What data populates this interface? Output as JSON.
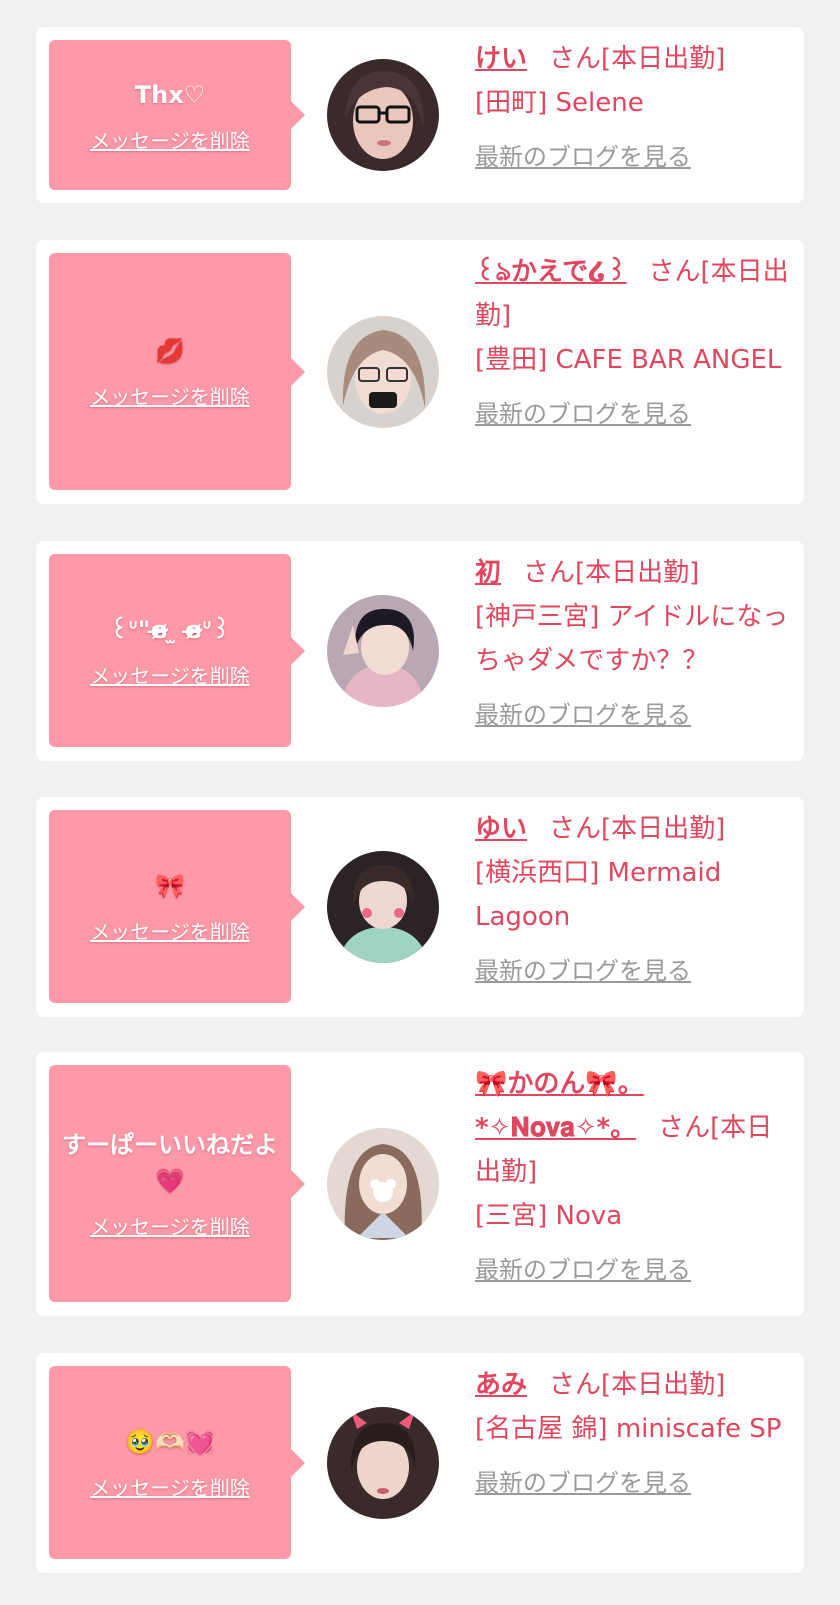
{
  "colors": {
    "accent": "#e0475f",
    "bubble": "#fd99a8",
    "background": "#f1f1f2"
  },
  "common": {
    "san": "さん",
    "delete_label": "メッセージを削除",
    "blog_label": "最新のブログを見る"
  },
  "items": [
    {
      "message": "Thx♡",
      "name": "けい",
      "status": "[本日出勤]",
      "shop": "[田町] Selene"
    },
    {
      "message": "💋",
      "name": "꒰ঌかえで໒꒱",
      "status": "[本日出勤]",
      "shop": "[豊田] CAFE BAR ANGEL"
    },
    {
      "message": "꒰ᐡ\"ɞ̴̶̷ ̫ ɞ̴̶̷ᐡ꒱",
      "name": "初",
      "status": "[本日出勤]",
      "shop": "[神戸三宮] アイドルになっちゃダメですか？？"
    },
    {
      "message": "🎀",
      "name": "ゆい",
      "status": "[本日出勤]",
      "shop": "[横浜西口] Mermaid Lagoon"
    },
    {
      "message": "すーぱーいいねだよ💗",
      "name": "🎀かのん🎀。*✧𝐍𝐨𝐯𝐚✧*。",
      "status": "[本日出勤]",
      "shop": "[三宮] Nova"
    },
    {
      "message": "🥹🫶🏻💓",
      "name": "あみ",
      "status": "[本日出勤]",
      "shop": "[名古屋 錦] miniscafe SP"
    }
  ]
}
